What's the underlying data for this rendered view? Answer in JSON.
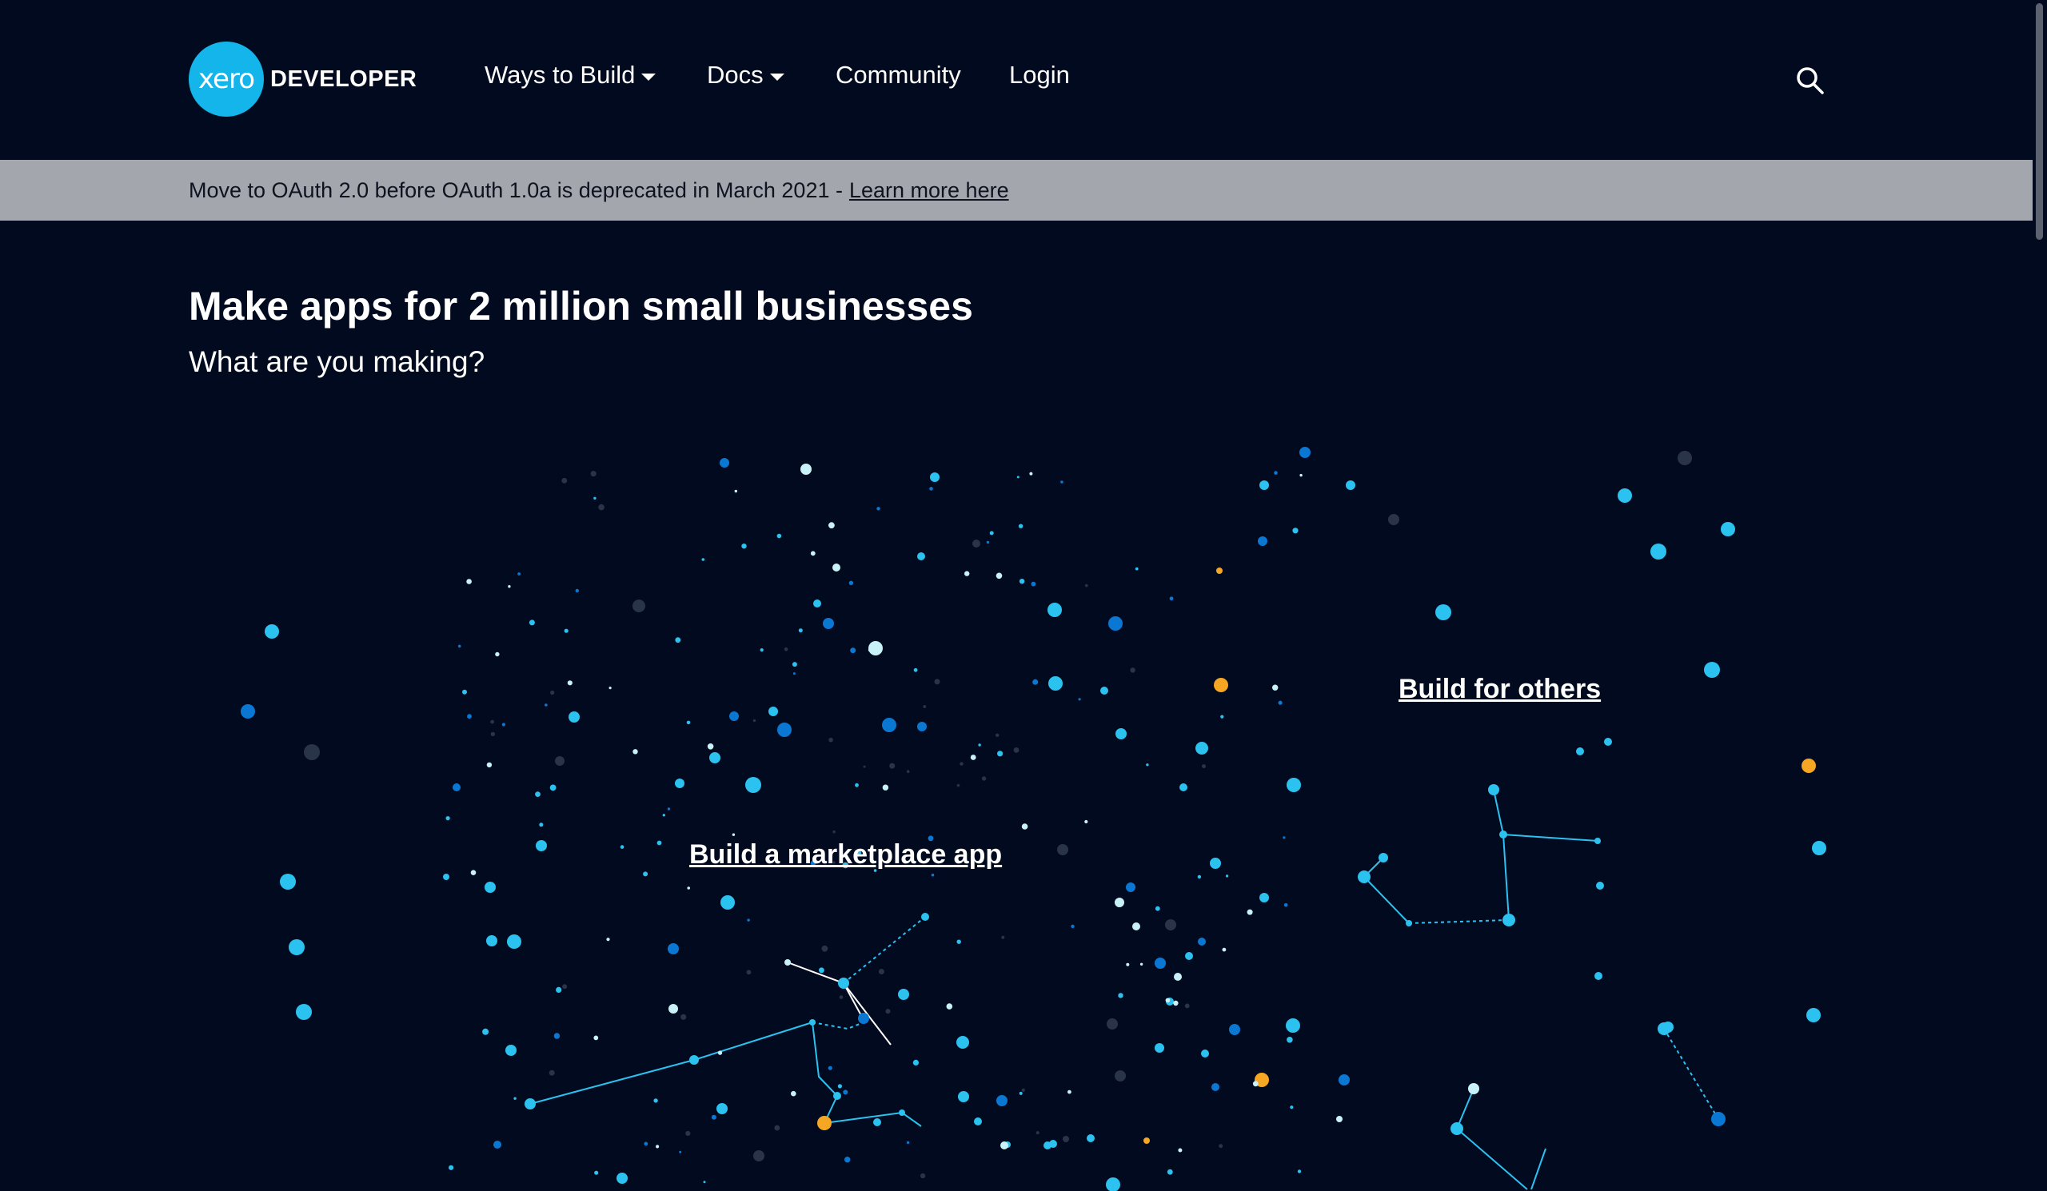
{
  "brand": {
    "logo_mark": "xero",
    "logo_text": "DEVELOPER",
    "color": "#13b5ea"
  },
  "nav": {
    "items": [
      {
        "label": "Ways to Build",
        "dropdown": true
      },
      {
        "label": "Docs",
        "dropdown": true
      },
      {
        "label": "Community",
        "dropdown": false
      },
      {
        "label": "Login",
        "dropdown": false
      }
    ],
    "search_icon": "search-icon"
  },
  "banner": {
    "text": "Move to OAuth 2.0 before OAuth 1.0a is deprecated in March 2021 -",
    "link_label": "Learn more here"
  },
  "hero": {
    "title": "Make apps for 2 million small businesses",
    "subtitle": "What are you making?"
  },
  "ctas": {
    "marketplace": "Build a marketplace app",
    "others": "Build for others"
  },
  "colors": {
    "background": "#020a1f",
    "banner": "#a3a6ad",
    "star_light": "#2bc2f0",
    "star_blue": "#0a78d2",
    "star_pale": "#c9f1f8",
    "star_dark": "#2a3448",
    "star_amber": "#f5a623"
  }
}
